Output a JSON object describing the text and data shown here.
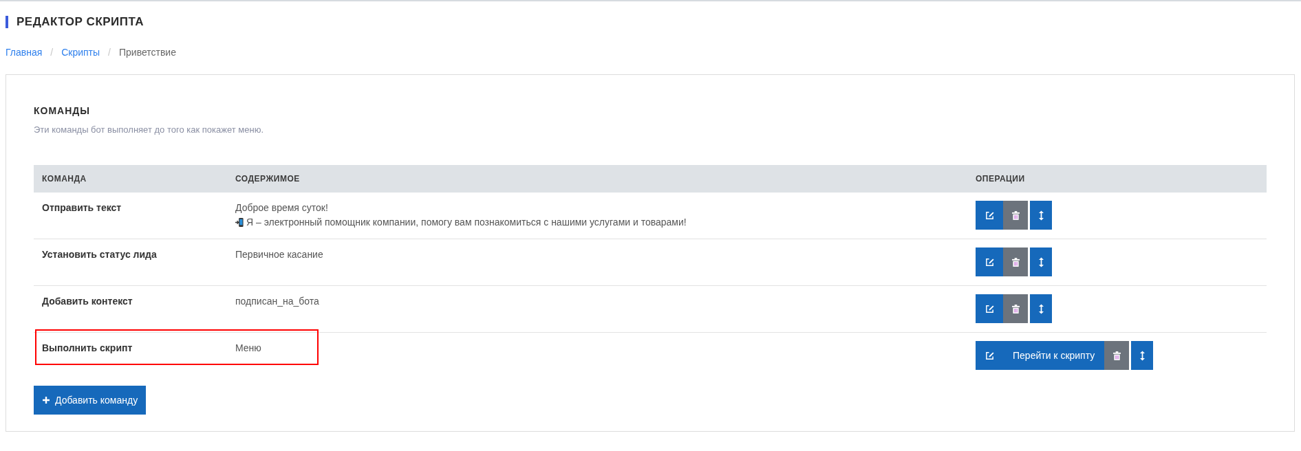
{
  "page_title": "РЕДАКТОР СКРИПТА",
  "breadcrumbs": [
    {
      "label": "Главная",
      "kind": "link"
    },
    {
      "separator": "/",
      "label": "Скрипты",
      "kind": "link"
    },
    {
      "separator": "/",
      "label": "Приветствие",
      "kind": "current"
    }
  ],
  "section": {
    "title": "КОМАНДЫ",
    "description": "Эти команды бот выполняет до того как покажет меню."
  },
  "table": {
    "columns": [
      "КОМАНДА",
      "СОДЕРЖИМОЕ",
      "ОПЕРАЦИИ"
    ],
    "rows": [
      {
        "command": "Отправить текст",
        "content": [
          {
            "text": "Доброе время суток!"
          },
          {
            "text": "Я – электронный помощник компании, помогу вам познакомиться с нашими услугами и товарами!",
            "icon": true
          }
        ],
        "operations": [
          {
            "kind": "edit"
          },
          {
            "kind": "delete"
          },
          {
            "kind": "move"
          }
        ]
      },
      {
        "command": "Установить статус лида",
        "content": [
          {
            "text": "Первичное касание"
          }
        ],
        "operations": [
          {
            "kind": "edit"
          },
          {
            "kind": "delete"
          },
          {
            "kind": "move"
          }
        ]
      },
      {
        "command": "Добавить контекст",
        "content": [
          {
            "text": "подписан_на_бота"
          }
        ],
        "operations": [
          {
            "kind": "edit"
          },
          {
            "kind": "delete"
          },
          {
            "kind": "move"
          }
        ]
      },
      {
        "command": "Выполнить скрипт",
        "highlighted": true,
        "content": [
          {
            "text": "Меню"
          }
        ],
        "operations": [
          {
            "kind": "edit"
          },
          {
            "kind": "goto",
            "label": "Перейти к скрипту"
          },
          {
            "kind": "delete"
          },
          {
            "kind": "move"
          }
        ]
      }
    ]
  },
  "add_button": {
    "label": "Добавить команду"
  }
}
